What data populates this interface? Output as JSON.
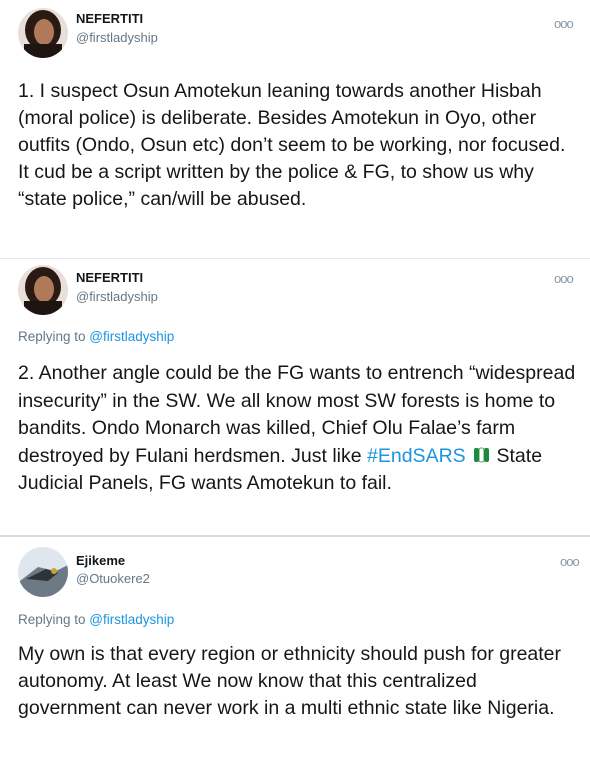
{
  "tweets": [
    {
      "name": "NEFERTITI",
      "handle": "@firstladyship",
      "more": "ooo",
      "body": "1. I suspect Osun Amotekun leaning towards another Hisbah (moral police) is deliberate. Besides Amotekun in Oyo, other outfits (Ondo, Osun etc) don’t seem to be working, nor focused. It cud be a script written by the police & FG, to show us why “state police,” can/will be abused."
    },
    {
      "name": "NEFERTITI",
      "handle": "@firstladyship",
      "more": "ooo",
      "replying_prefix": "Replying to ",
      "replying_to": "@firstladyship",
      "body_part1": "2. Another angle could be the FG wants to entrench “widespread insecurity” in the SW. We all know most SW forests is home to bandits. Ondo Monarch was killed, Chief Olu Falae’s farm destroyed by Fulani herdsmen. Just like ",
      "hashtag": "#EndSARS",
      "body_part2": " State Judicial Panels, FG wants Amotekun to fail."
    },
    {
      "name": "Ejikeme",
      "handle": "@Otuokere2",
      "more": "ooo",
      "replying_prefix": "Replying to ",
      "replying_to": "@firstladyship",
      "body": "My own is that every region or ethnicity should push for greater autonomy. At least We now know that this centralized government can never work in a multi ethnic state like Nigeria."
    }
  ],
  "colors": {
    "link": "#1b95e0",
    "muted": "#657786",
    "text": "#14171a"
  },
  "icons": [
    "avatar-woman",
    "endsars-flag-fist-icon",
    "avatar-eagle",
    "more-icon"
  ]
}
